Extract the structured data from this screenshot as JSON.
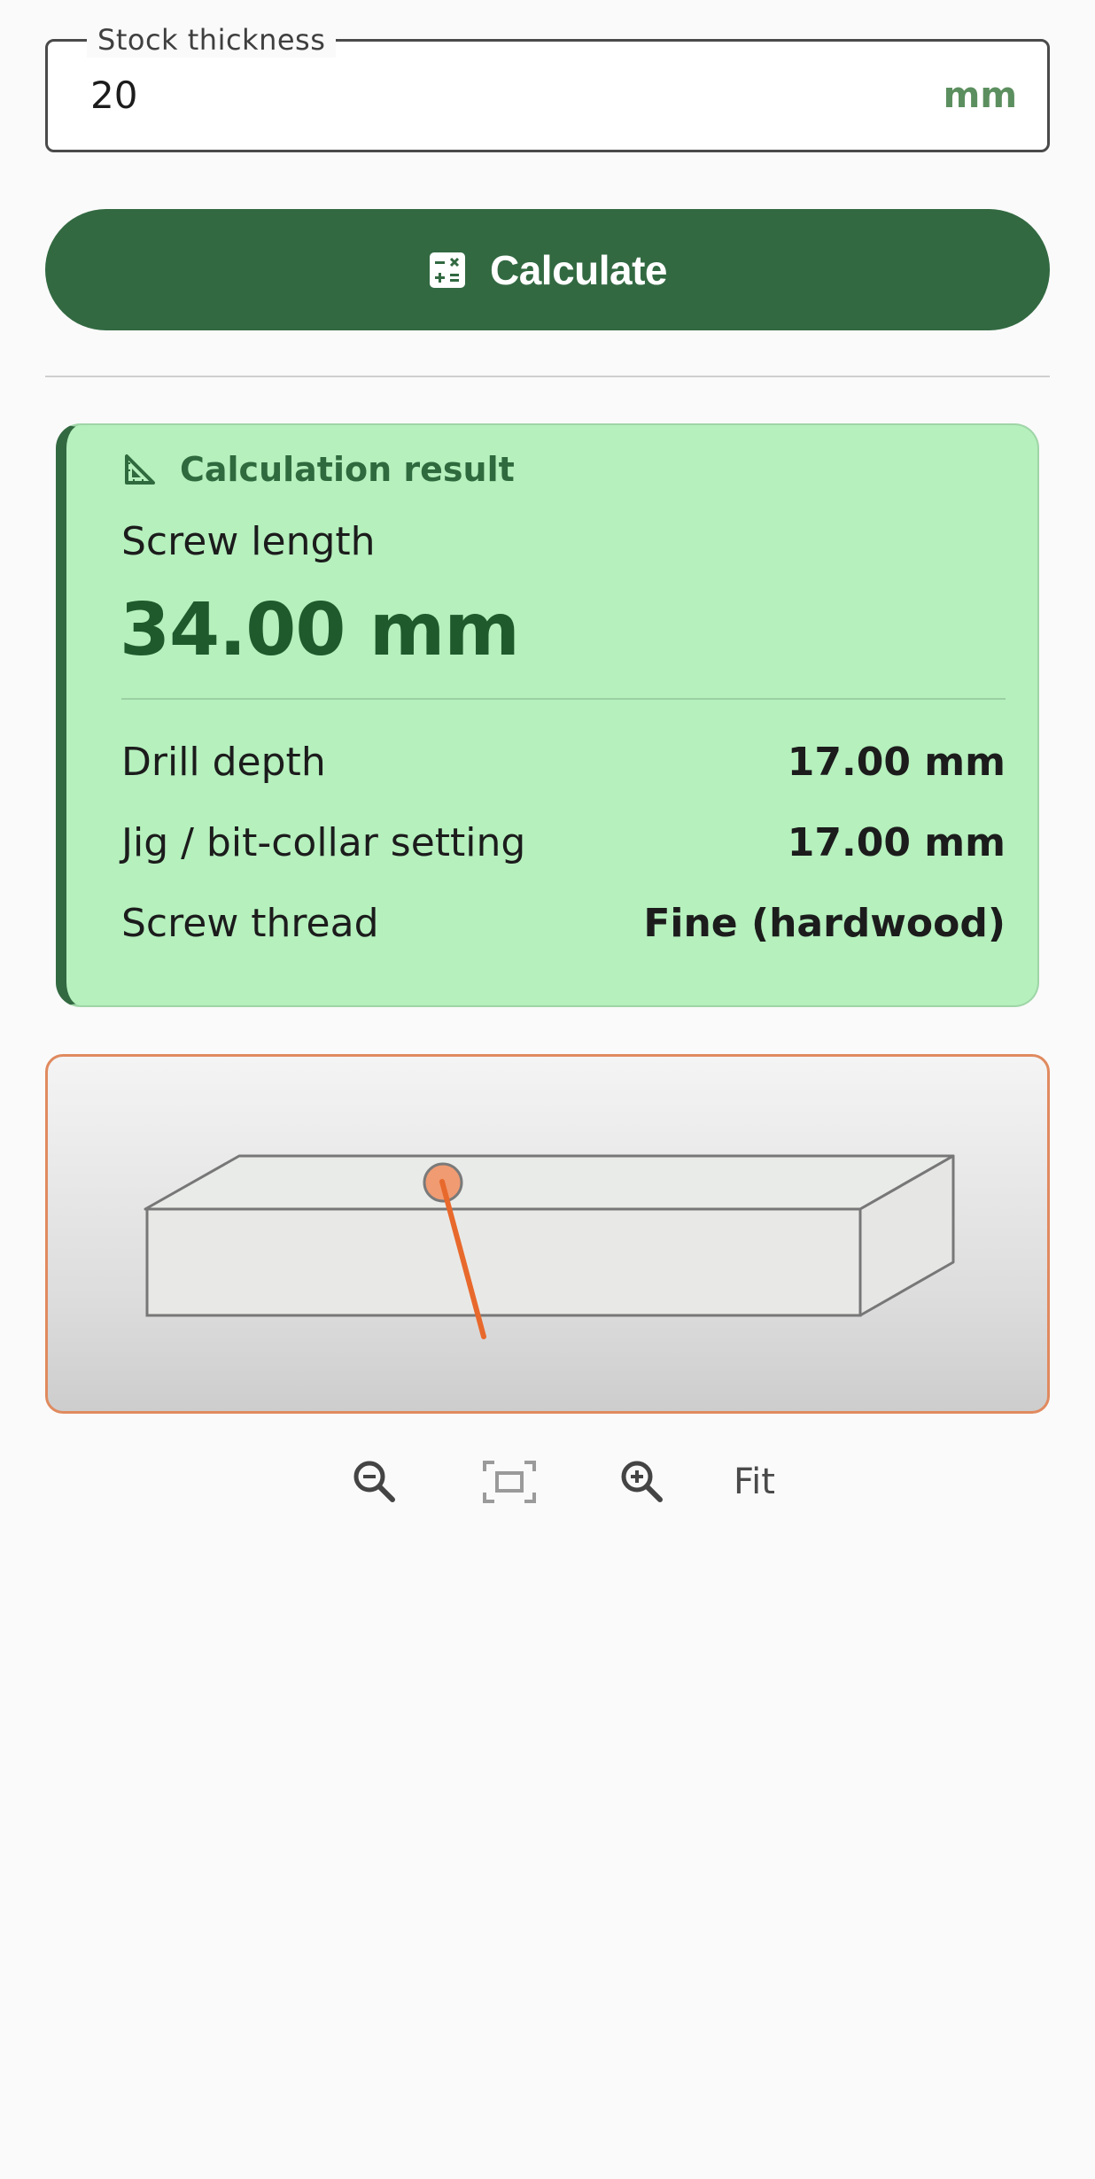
{
  "stock_field": {
    "label": "Stock thickness",
    "value": "20",
    "suffix": "mm"
  },
  "calculate_button": {
    "label": "Calculate",
    "icon": "calculator-icon"
  },
  "result": {
    "title": "Calculation result",
    "icon": "set-square-icon",
    "main_label": "Screw length",
    "main_value": "34.00 mm",
    "rows": [
      {
        "label": "Drill depth",
        "value": "17.00 mm"
      },
      {
        "label": "Jig / bit-collar setting",
        "value": "17.00 mm"
      },
      {
        "label": "Screw thread",
        "value": "Fine (hardwood)"
      }
    ]
  },
  "diagram": {
    "description_icon": "pocket-hole-board-diagram",
    "accent_color": "#e8692c"
  },
  "zoom": {
    "zoom_out_icon": "zoom-out-icon",
    "fit_icon": "fit-screen-icon",
    "zoom_in_icon": "zoom-in-icon",
    "fit_label": "Fit"
  },
  "colors": {
    "primary": "#326941",
    "result_bg": "#b5f0bd",
    "accent": "#e8692c"
  }
}
